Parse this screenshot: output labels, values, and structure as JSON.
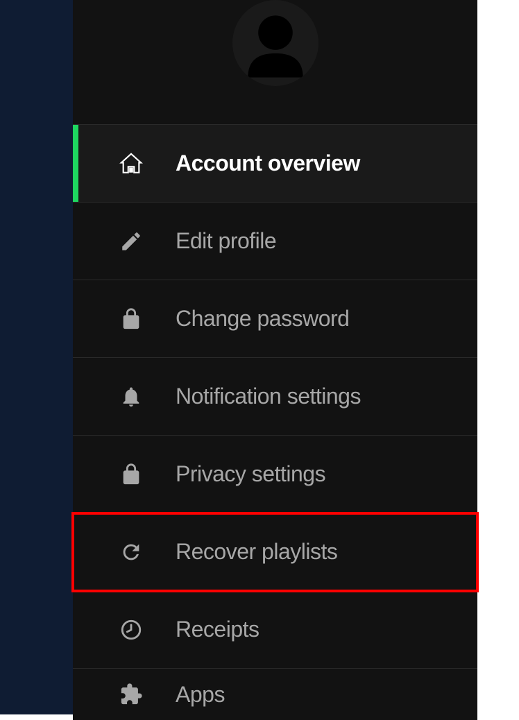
{
  "menu": {
    "items": [
      {
        "label": "Account overview",
        "active": true
      },
      {
        "label": "Edit profile",
        "active": false
      },
      {
        "label": "Change password",
        "active": false
      },
      {
        "label": "Notification settings",
        "active": false
      },
      {
        "label": "Privacy settings",
        "active": false
      },
      {
        "label": "Recover playlists",
        "active": false,
        "highlighted": true
      },
      {
        "label": "Receipts",
        "active": false
      },
      {
        "label": "Apps",
        "active": false
      }
    ]
  }
}
